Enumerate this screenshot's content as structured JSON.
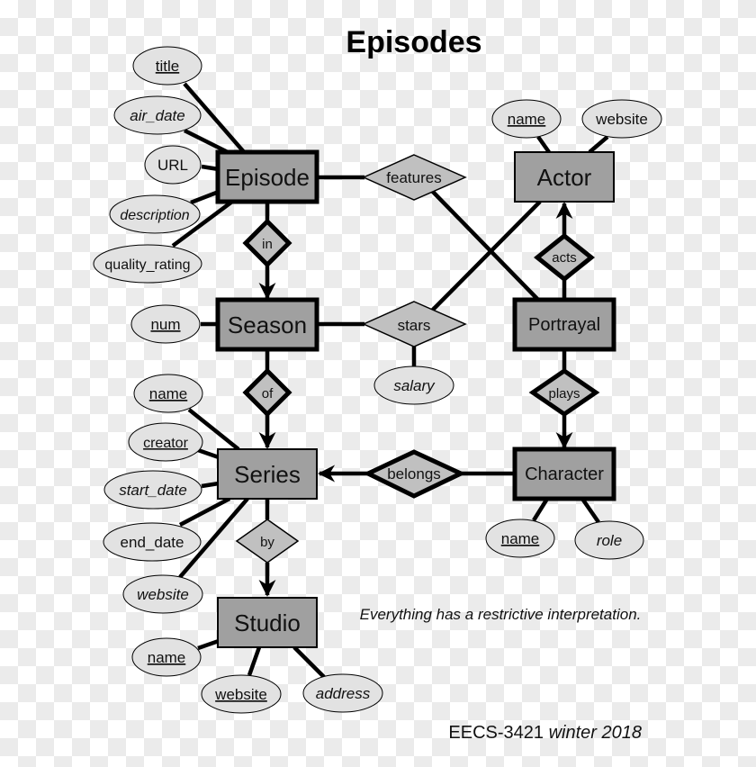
{
  "title": "Episodes",
  "note": "Everything has a restrictive interpretation.",
  "footer": {
    "course": "EECS-3421",
    "term": "winter",
    "year": "2018"
  },
  "colors": {
    "entity_fill": "#a0a0a0",
    "relationship_fill": "#c0c0c0",
    "attribute_fill": "#e2e2e2",
    "stroke": "#000000"
  },
  "entities": {
    "episode": {
      "label": "Episode",
      "weak": true
    },
    "season": {
      "label": "Season",
      "weak": true
    },
    "series": {
      "label": "Series",
      "weak": false
    },
    "studio": {
      "label": "Studio",
      "weak": false
    },
    "actor": {
      "label": "Actor",
      "weak": false
    },
    "portrayal": {
      "label": "Portrayal",
      "weak": true
    },
    "character": {
      "label": "Character",
      "weak": true
    }
  },
  "relationships": {
    "in": {
      "label": "in",
      "identifying": true
    },
    "of": {
      "label": "of",
      "identifying": true
    },
    "by": {
      "label": "by",
      "identifying": false
    },
    "features": {
      "label": "features",
      "identifying": false
    },
    "stars": {
      "label": "stars",
      "identifying": false
    },
    "acts": {
      "label": "acts",
      "identifying": true
    },
    "plays": {
      "label": "plays",
      "identifying": true
    },
    "belongs": {
      "label": "belongs",
      "identifying": true
    }
  },
  "attributes": {
    "episode": [
      {
        "label": "title",
        "key": true,
        "italic": false
      },
      {
        "label": "air_date",
        "key": false,
        "italic": true
      },
      {
        "label": "URL",
        "key": false,
        "italic": false
      },
      {
        "label": "description",
        "key": false,
        "italic": true
      },
      {
        "label": "quality_rating",
        "key": false,
        "italic": false
      }
    ],
    "season": [
      {
        "label": "num",
        "key": true,
        "italic": false
      }
    ],
    "series": [
      {
        "label": "name",
        "key": true,
        "italic": false
      },
      {
        "label": "creator",
        "key": true,
        "italic": false
      },
      {
        "label": "start_date",
        "key": false,
        "italic": true
      },
      {
        "label": "end_date",
        "key": false,
        "italic": false
      },
      {
        "label": "website",
        "key": false,
        "italic": true
      }
    ],
    "studio": [
      {
        "label": "name",
        "key": true,
        "italic": false
      },
      {
        "label": "website",
        "key": true,
        "italic": false
      },
      {
        "label": "address",
        "key": false,
        "italic": true
      }
    ],
    "actor": [
      {
        "label": "name",
        "key": true,
        "italic": false
      },
      {
        "label": "website",
        "key": false,
        "italic": false
      }
    ],
    "stars": [
      {
        "label": "salary",
        "key": false,
        "italic": true
      }
    ],
    "character": [
      {
        "label": "name",
        "key": true,
        "italic": false
      },
      {
        "label": "role",
        "key": false,
        "italic": true
      }
    ]
  }
}
